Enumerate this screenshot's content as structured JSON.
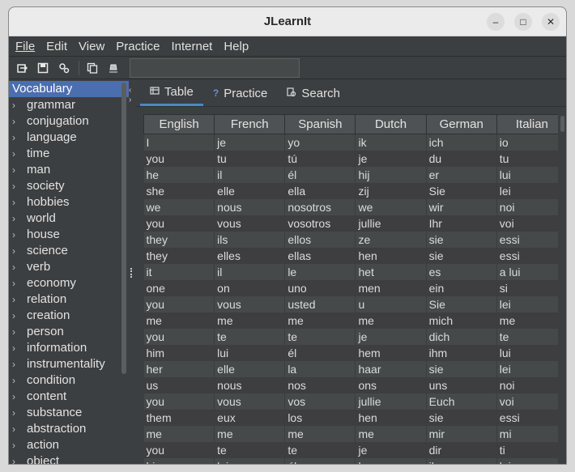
{
  "app": {
    "title": "JLearnIt"
  },
  "window_controls": {
    "minimize": "–",
    "maximize": "□",
    "close": "✕"
  },
  "menu": [
    "File",
    "Edit",
    "View",
    "Practice",
    "Internet",
    "Help"
  ],
  "toolbar": {
    "icons": [
      "export-icon",
      "save-icon",
      "settings-icon",
      "copy-icon",
      "stamp-icon"
    ],
    "search_value": ""
  },
  "tree": {
    "root": "Vocabulary",
    "items": [
      "grammar",
      "conjugation",
      "language",
      "time",
      "man",
      "society",
      "hobbies",
      "world",
      "house",
      "science",
      "verb",
      "economy",
      "relation",
      "creation",
      "person",
      "information",
      "instrumentality",
      "condition",
      "content",
      "substance",
      "abstraction",
      "action",
      "object"
    ]
  },
  "tabs": [
    {
      "label": "Table",
      "icon": "table-icon",
      "active": true
    },
    {
      "label": "Practice",
      "icon": "question-icon",
      "active": false
    },
    {
      "label": "Search",
      "icon": "search-icon",
      "active": false
    }
  ],
  "table": {
    "columns": [
      "English",
      "French",
      "Spanish",
      "Dutch",
      "German",
      "Italian"
    ],
    "rows": [
      [
        "I",
        "je",
        "yo",
        "ik",
        "ich",
        "io"
      ],
      [
        "you",
        "tu",
        "tú",
        "je",
        "du",
        "tu"
      ],
      [
        "he",
        "il",
        "él",
        "hij",
        "er",
        "lui"
      ],
      [
        "she",
        "elle",
        "ella",
        "zij",
        "Sie",
        "lei"
      ],
      [
        "we",
        "nous",
        "nosotros",
        "we",
        "wir",
        "noi"
      ],
      [
        "you",
        "vous",
        "vosotros",
        "jullie",
        "Ihr",
        "voi"
      ],
      [
        "they",
        "ils",
        "ellos",
        "ze",
        "sie",
        "essi"
      ],
      [
        "they",
        "elles",
        "ellas",
        "hen",
        "sie",
        "essi"
      ],
      [
        "it",
        "il",
        "le",
        "het",
        "es",
        "a lui"
      ],
      [
        "one",
        "on",
        "uno",
        "men",
        "ein",
        "si"
      ],
      [
        "you",
        "vous",
        "usted",
        "u",
        "Sie",
        "lei"
      ],
      [
        "me",
        "me",
        "me",
        "me",
        "mich",
        "me"
      ],
      [
        "you",
        "te",
        "te",
        "je",
        "dich",
        "te"
      ],
      [
        "him",
        "lui",
        "él",
        "hem",
        "ihm",
        "lui"
      ],
      [
        "her",
        "elle",
        "la",
        "haar",
        "sie",
        "lei"
      ],
      [
        "us",
        "nous",
        "nos",
        "ons",
        "uns",
        "noi"
      ],
      [
        "you",
        "vous",
        "vos",
        "jullie",
        "Euch",
        "voi"
      ],
      [
        "them",
        "eux",
        "los",
        "hen",
        "sie",
        "essi"
      ],
      [
        "me",
        "me",
        "me",
        "me",
        "mir",
        "mi"
      ],
      [
        "you",
        "te",
        "te",
        "je",
        "dir",
        "ti"
      ],
      [
        "him",
        "lui",
        "él",
        "hem",
        "ihm",
        "lui"
      ]
    ]
  },
  "colors": {
    "background": "#3c3f41",
    "selection": "#4b6eaf",
    "tab_indicator": "#4a88c7"
  }
}
